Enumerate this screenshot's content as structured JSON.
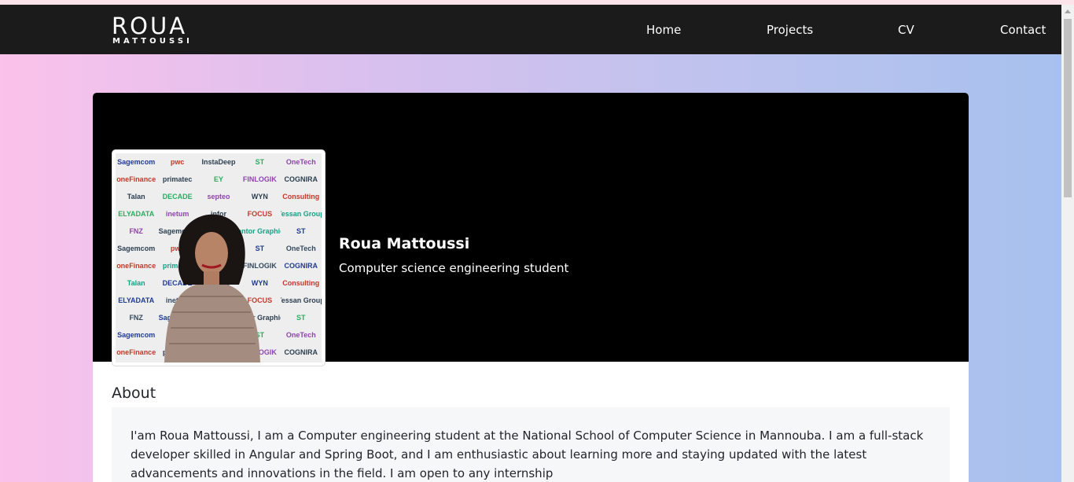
{
  "brand": {
    "name_top": "ROUA",
    "name_bottom": "MATTOUSSI"
  },
  "nav": {
    "items": [
      {
        "label": "Home"
      },
      {
        "label": "Projects"
      },
      {
        "label": "CV"
      },
      {
        "label": "Contact"
      }
    ]
  },
  "profile": {
    "name": "Roua Mattoussi",
    "subtitle": "Computer science engineering student",
    "photo_logos": [
      "Sagemcom",
      "pwc",
      "InstaDeep",
      "ST",
      "OneTech",
      "oneFinance",
      "primatec",
      "EY",
      "FINLOGIK",
      "COGNIRA",
      "Talan",
      "DECADE",
      "septeo",
      "WYN",
      "Consulting",
      "ELYADATA",
      "inetum",
      "infor",
      "FOCUS",
      "Tessan Group",
      "FNZ",
      "Sagemcom",
      "pwc",
      "Mentor Graphics",
      "ST"
    ]
  },
  "about": {
    "title": "About",
    "text": "I'am Roua Mattoussi, I am a Computer engineering student at the National School of Computer Science in Mannouba. I am a full-stack developer skilled in Angular and Spring Boot, and I am enthusiastic about learning more and staying updated with the latest advancements and innovations in the field. I am open to any internship"
  },
  "colors": {
    "navbar": "#1b1b1b",
    "card_header": "#000000",
    "gradient_left": "#fbc2eb",
    "gradient_right": "#a6c1ee",
    "about_box": "#f6f7f9"
  }
}
